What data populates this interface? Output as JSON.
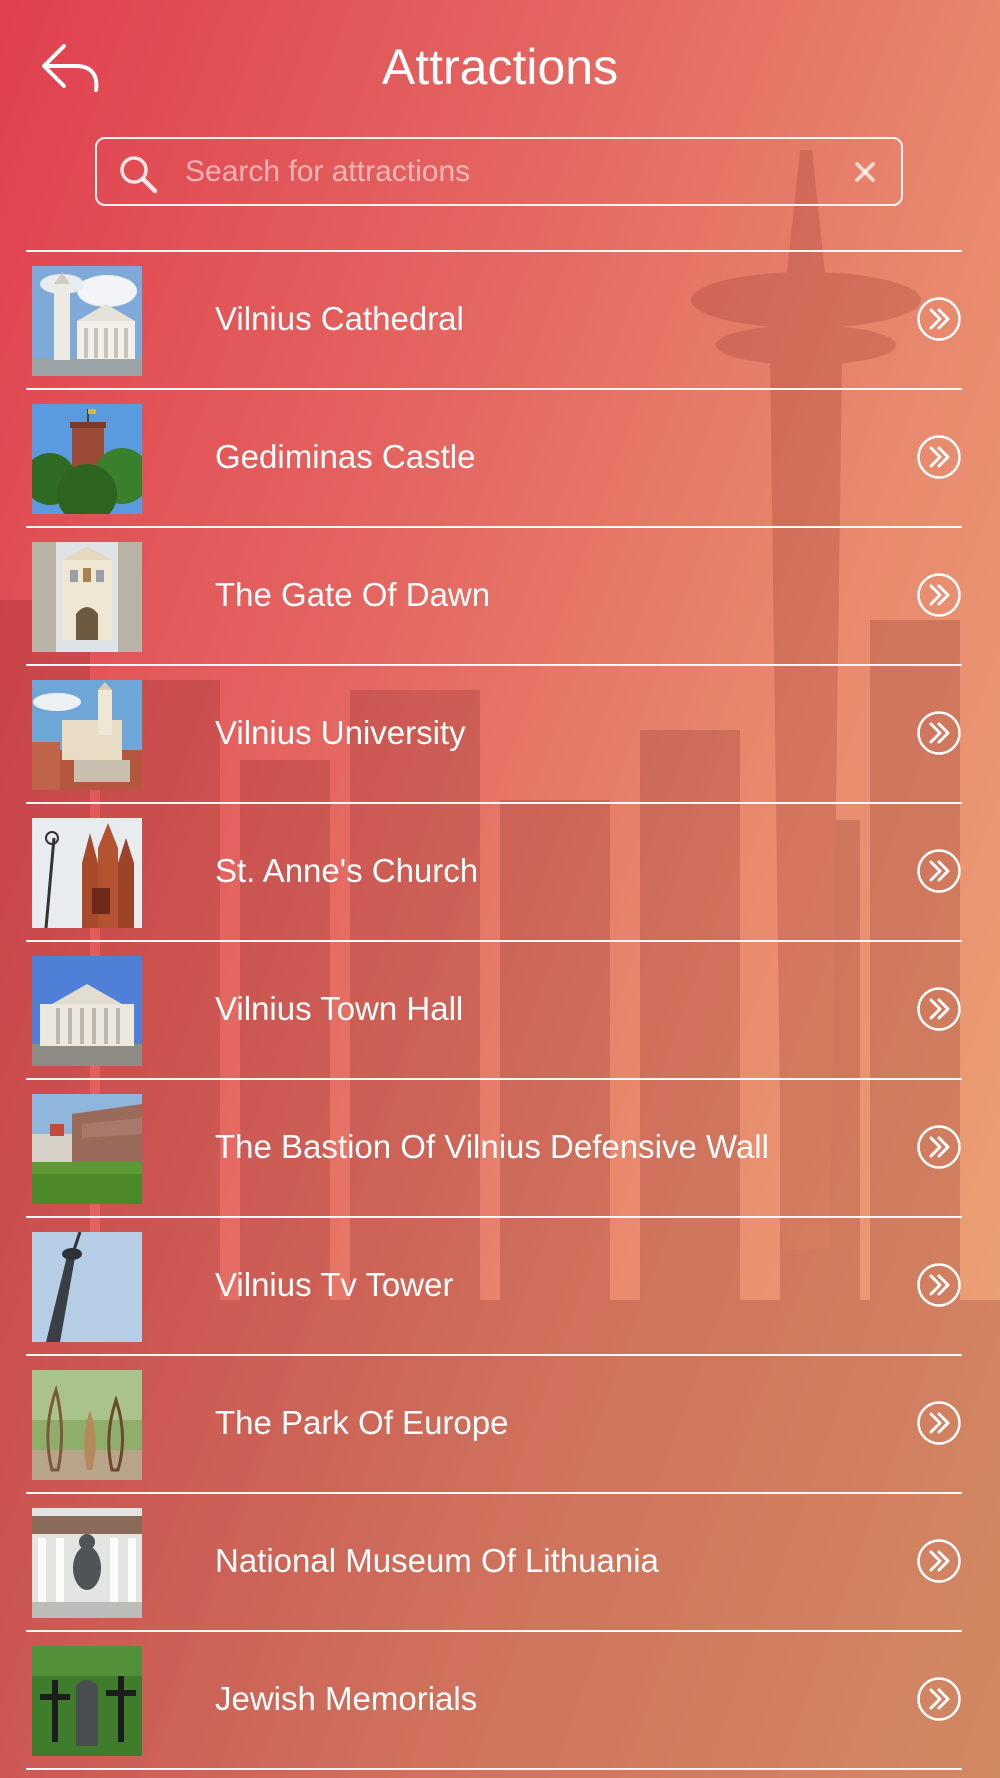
{
  "header": {
    "title": "Attractions"
  },
  "search": {
    "placeholder": "Search for attractions",
    "value": ""
  },
  "icons": {
    "back": "back-arrow-icon",
    "search": "magnifier-icon",
    "clear": "close-icon",
    "row_action": "double-chevron-circle-icon"
  },
  "colors": {
    "gradient_start": "#e0404f",
    "gradient_end": "#eba877",
    "text": "#ffffff"
  },
  "attractions": [
    {
      "name": "Vilnius Cathedral",
      "thumb": "cathedral"
    },
    {
      "name": "Gediminas Castle",
      "thumb": "castle"
    },
    {
      "name": "The Gate Of Dawn",
      "thumb": "gate"
    },
    {
      "name": "Vilnius University",
      "thumb": "university"
    },
    {
      "name": "St. Anne's Church",
      "thumb": "church"
    },
    {
      "name": "Vilnius Town Hall",
      "thumb": "townhall"
    },
    {
      "name": "The Bastion Of Vilnius Defensive Wall",
      "thumb": "bastion"
    },
    {
      "name": "Vilnius Tv Tower",
      "thumb": "tvtower"
    },
    {
      "name": "The Park Of Europe",
      "thumb": "park"
    },
    {
      "name": "National Museum Of Lithuania",
      "thumb": "museum"
    },
    {
      "name": "Jewish Memorials",
      "thumb": "memorials"
    }
  ]
}
